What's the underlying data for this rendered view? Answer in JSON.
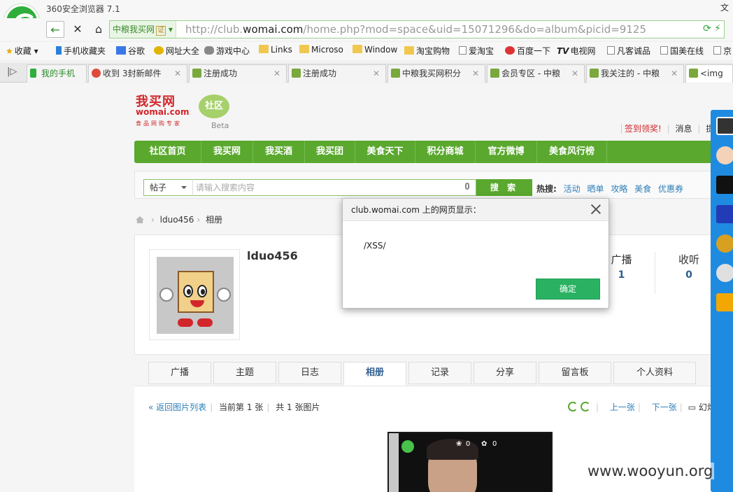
{
  "browser": {
    "title": "360安全浏览器 7.1",
    "win_right": "文",
    "site_badge": "中粮我买网",
    "cert": "证",
    "url_prefix": "http://club.",
    "url_domain": "womai.com",
    "url_rest": "/home.php?mod=space&uid=15071296&do=album&picid=9125",
    "bookmarks": [
      "收藏",
      "手机收藏夹",
      "谷歌",
      "网址大全",
      "游戏中心",
      "Links",
      "Microso",
      "Window",
      "淘宝购物",
      "爱淘宝",
      "百度一下",
      "电视网",
      "凡客诚品",
      "国美在线",
      "京"
    ],
    "tabs": [
      "我的手机",
      "收到 3封新邮件",
      "注册成功",
      "注册成功",
      "中粮我买网积分",
      "会员专区 - 中粮",
      "我关注的 - 中粮",
      "<img"
    ]
  },
  "site": {
    "logo_main": "我买网",
    "logo_sub": "womai.com",
    "logo_tag": "食品网购专家",
    "logo_bubble": "社区",
    "logo_beta": "Beta",
    "toplinks": {
      "sign": "签到领奖!",
      "msg": "消息",
      "remind": "提醒"
    },
    "nav": [
      "社区首页",
      "我买网",
      "我买酒",
      "我买团",
      "美食天下",
      "积分商城",
      "官方微博",
      "美食风行榜"
    ],
    "search": {
      "select": "帖子",
      "placeholder": "请输入搜索内容",
      "button": "搜 索",
      "hot_label": "热搜:",
      "hot": [
        "活动",
        "晒单",
        "攻略",
        "美食",
        "优惠券"
      ]
    },
    "breadcrumb": [
      "lduo456",
      "相册"
    ],
    "profile": {
      "username": "lduo456",
      "stats": [
        {
          "label": "广播",
          "value": "1"
        },
        {
          "label": "收听",
          "value": "0"
        }
      ]
    },
    "subtabs": [
      "广播",
      "主题",
      "日志",
      "相册",
      "记录",
      "分享",
      "留言板",
      "个人资料"
    ],
    "active_subtab": "相册",
    "gallery": {
      "back": "« 返回图片列表",
      "current": "当前第 1 张",
      "total": "共 1 张图片",
      "prev": "上一张",
      "next": "下一张",
      "slideshow": "幻灯",
      "photo_stat_1": "0",
      "photo_stat_2": "0"
    }
  },
  "modal": {
    "title": "club.womai.com 上的网页显示：",
    "message": "/XSS/",
    "ok": "确定"
  },
  "watermark": "www.wooyun.org",
  "colors": {
    "accent_green": "#5aa82e",
    "link_blue": "#2f7fb8",
    "ok_green": "#2ab262",
    "brand_red": "#d2262b",
    "sidebar_blue": "#1f8be0"
  }
}
